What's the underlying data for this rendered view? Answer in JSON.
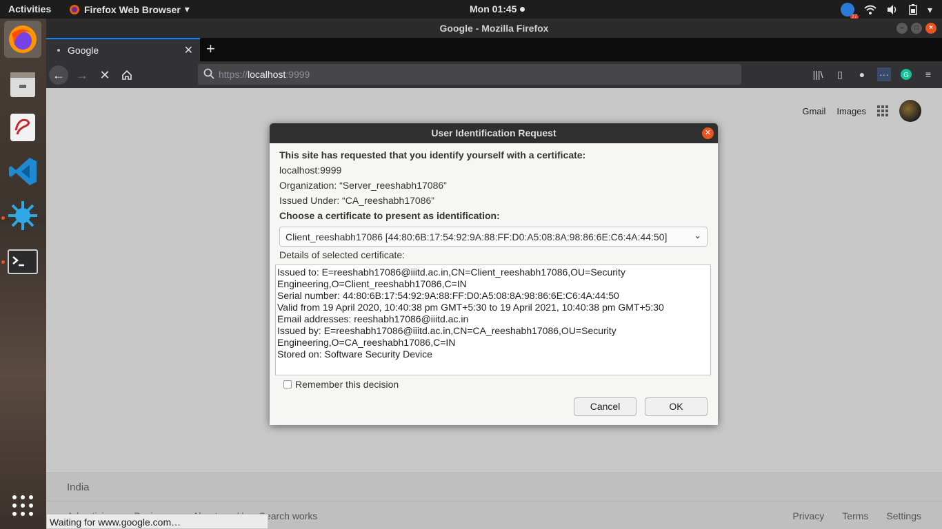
{
  "topbar": {
    "activities": "Activities",
    "app_name": "Firefox Web Browser",
    "clock": "Mon 01:45",
    "tray_badge": "77"
  },
  "window": {
    "title": "Google - Mozilla Firefox"
  },
  "tab": {
    "label": "Google"
  },
  "urlbar": {
    "protocol": "https://",
    "host": "localhost",
    "port": ":9999"
  },
  "google": {
    "gmail": "Gmail",
    "images": "Images",
    "country": "India",
    "footer_left": [
      "Advertising",
      "Business",
      "About",
      "How Search works"
    ],
    "footer_right": [
      "Privacy",
      "Terms",
      "Settings"
    ]
  },
  "status": "Waiting for www.google.com…",
  "dialog": {
    "title": "User Identification Request",
    "intro": "This site has requested that you identify yourself with a certificate:",
    "host": "localhost:9999",
    "organization": "Organization: “Server_reeshabh17086”",
    "issued_under": "Issued Under: “CA_reeshabh17086”",
    "choose_label": "Choose a certificate to present as identification:",
    "selected_cert": "Client_reeshabh17086 [44:80:6B:17:54:92:9A:88:FF:D0:A5:08:8A:98:86:6E:C6:4A:44:50]",
    "details_label": "Details of selected certificate:",
    "details": [
      "Issued to: E=reeshabh17086@iiitd.ac.in,CN=Client_reeshabh17086,OU=Security",
      "Engineering,O=Client_reeshabh17086,C=IN",
      "Serial number: 44:80:6B:17:54:92:9A:88:FF:D0:A5:08:8A:98:86:6E:C6:4A:44:50",
      "Valid from 19 April 2020, 10:40:38 pm GMT+5:30 to 19 April 2021, 10:40:38 pm GMT+5:30",
      "Email addresses: reeshabh17086@iiitd.ac.in",
      "Issued by: E=reeshabh17086@iiitd.ac.in,CN=CA_reeshabh17086,OU=Security",
      "Engineering,O=CA_reeshabh17086,C=IN",
      "Stored on: Software Security Device"
    ],
    "remember_label": "Remember this decision",
    "remember_checked": false,
    "cancel_label": "Cancel",
    "ok_label": "OK"
  },
  "colors": {
    "accent": "#e95420",
    "firefox_tab_highlight": "#0a84ff"
  }
}
